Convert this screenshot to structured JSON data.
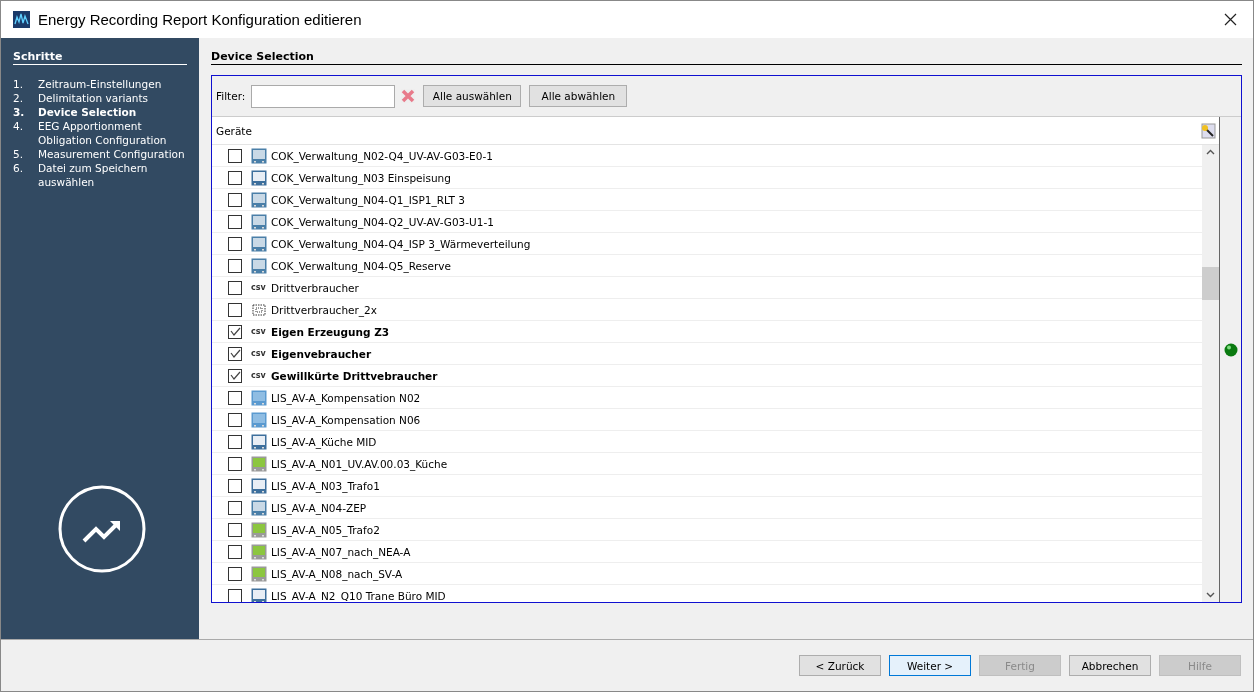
{
  "window": {
    "title": "Energy Recording Report Konfiguration editieren"
  },
  "sidebar": {
    "title": "Schritte",
    "steps": [
      {
        "number": "1.",
        "label": "Zeitraum-Einstellungen",
        "selected": false
      },
      {
        "number": "2.",
        "label": "Delimitation variants",
        "selected": false
      },
      {
        "number": "3.",
        "label": "Device Selection",
        "selected": true
      },
      {
        "number": "4.",
        "label": "EEG Apportionment Obligation Configuration",
        "selected": false
      },
      {
        "number": "5.",
        "label": "Measurement Configuration",
        "selected": false
      },
      {
        "number": "6.",
        "label": "Datei zum Speichern auswählen",
        "selected": false
      }
    ]
  },
  "section_title": "Device Selection",
  "filter": {
    "label": "Filter:"
  },
  "select_buttons": [
    "Alle auswählen",
    "Alle abwählen"
  ],
  "table": {
    "column": "Geräte",
    "rows": [
      {
        "kind": "grid-meter",
        "name": "COK_Verwaltung_N02-Q4_UV-AV-G03-E0-1",
        "checked": false
      },
      {
        "kind": "screen-meter",
        "name": "COK_Verwaltung_N03 Einspeisung",
        "checked": false
      },
      {
        "kind": "grid-meter",
        "name": "COK_Verwaltung_N04-Q1_ISP1_RLT 3",
        "checked": false
      },
      {
        "kind": "grid-meter",
        "name": "COK_Verwaltung_N04-Q2_UV-AV-G03-U1-1",
        "checked": false
      },
      {
        "kind": "grid-meter",
        "name": "COK_Verwaltung_N04-Q4_ISP 3_Wärmeverteilung",
        "checked": false
      },
      {
        "kind": "grid-meter",
        "name": "COK_Verwaltung_N04-Q5_Reserve",
        "checked": false
      },
      {
        "kind": "csv",
        "badge": "csv",
        "name": "Drittverbraucher",
        "checked": false
      },
      {
        "kind": "virtual",
        "name": "Drittverbraucher_2x",
        "checked": false
      },
      {
        "kind": "csv",
        "badge": "csv",
        "name": "Eigen Erzeugung Z3",
        "checked": true
      },
      {
        "kind": "csv",
        "badge": "csv",
        "name": "Eigenvebraucher",
        "checked": true
      },
      {
        "kind": "csv",
        "badge": "csv",
        "name": "Gewillkürte Drittvebraucher",
        "checked": true
      },
      {
        "kind": "panel-meter",
        "name": "LIS_AV-A_Kompensation N02",
        "checked": false
      },
      {
        "kind": "panel-meter",
        "name": "LIS_AV-A_Kompensation N06",
        "checked": false
      },
      {
        "kind": "screen-meter",
        "name": "LIS_AV-A_Küche MID",
        "checked": false
      },
      {
        "kind": "lcd-meter",
        "name": "LIS_AV-A_N01_UV.AV.00.03_Küche",
        "checked": false
      },
      {
        "kind": "screen-meter",
        "name": "LIS_AV-A_N03_Trafo1",
        "checked": false
      },
      {
        "kind": "grid-meter",
        "name": "LIS_AV-A_N04-ZEP",
        "checked": false
      },
      {
        "kind": "lcd-meter",
        "name": "LIS_AV-A_N05_Trafo2",
        "checked": false
      },
      {
        "kind": "lcd-meter",
        "name": "LIS_AV-A_N07_nach_NEA-A",
        "checked": false
      },
      {
        "kind": "lcd-meter",
        "name": "LIS_AV-A_N08_nach_SV-A",
        "checked": false
      },
      {
        "kind": "screen-meter",
        "name": "LIS_AV-A_N2_Q10 Trane Büro MID",
        "checked": false
      }
    ]
  },
  "footer_buttons": [
    {
      "label": "< Zurück",
      "disabled": false,
      "default": false
    },
    {
      "label": "Weiter >",
      "disabled": false,
      "default": true
    },
    {
      "label": "Fertig",
      "disabled": true,
      "default": false
    },
    {
      "label": "Abbrechen",
      "disabled": false,
      "default": false
    },
    {
      "label": "Hilfe",
      "disabled": true,
      "default": false
    }
  ]
}
